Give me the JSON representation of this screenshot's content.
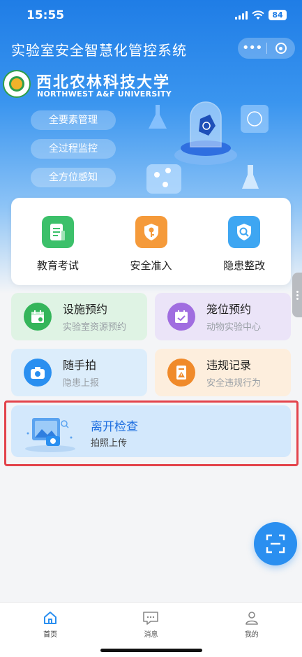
{
  "status_bar": {
    "time": "15:55",
    "battery": "84"
  },
  "header": {
    "title": "实验室安全智慧化管控系统",
    "menu_glyph": "•••"
  },
  "university": {
    "name_cn": "西北农林科技大学",
    "name_en": "NORTHWEST A&F UNIVERSITY"
  },
  "feature_tags": [
    "全要素管理",
    "全过程监控",
    "全方位感知"
  ],
  "quick_actions": [
    {
      "label": "教育考试",
      "icon": "exam-icon",
      "color": "#3cc06a"
    },
    {
      "label": "安全准入",
      "icon": "key-shield-icon",
      "color": "#f59a3a"
    },
    {
      "label": "隐患整改",
      "icon": "search-shield-icon",
      "color": "#3ea6f2"
    }
  ],
  "tiles": [
    {
      "title": "设施预约",
      "subtitle": "实验室资源预约",
      "icon": "calendar-icon",
      "bg": "#dff3e4",
      "icon_bg": "#34b55a"
    },
    {
      "title": "笼位预约",
      "subtitle": "动物实验中心",
      "icon": "calendar-check-icon",
      "bg": "#ebe4f8",
      "icon_bg": "#a06de0"
    },
    {
      "title": "随手拍",
      "subtitle": "隐患上报",
      "icon": "camera-icon",
      "bg": "#dcedfb",
      "icon_bg": "#2a8ff0"
    },
    {
      "title": "违规记录",
      "subtitle": "安全违规行为",
      "icon": "warning-document-icon",
      "bg": "#fdeedd",
      "icon_bg": "#f08a2a"
    }
  ],
  "leave_check": {
    "title": "离开检查",
    "subtitle": "拍照上传"
  },
  "tabbar": [
    {
      "label": "首页",
      "icon": "home-icon"
    },
    {
      "label": "消息",
      "icon": "message-icon"
    },
    {
      "label": "我的",
      "icon": "user-icon"
    }
  ]
}
